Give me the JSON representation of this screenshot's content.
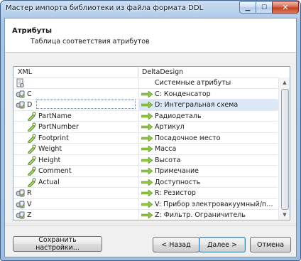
{
  "window": {
    "title": "Мастер импорта библиотеки из файла формата DDL",
    "min_icon": "minimize-icon",
    "max_icon": "maximize-icon",
    "close_icon": "close-icon"
  },
  "header": {
    "title": "Атрибуты",
    "subtitle": "Таблица соответствия атрибутов"
  },
  "table": {
    "columns": [
      "XML",
      "DeltaDesign"
    ],
    "rows": [
      {
        "xml": "",
        "delta": "Системные атрибуты",
        "icon": "document-tree-icon",
        "indent": 0,
        "arrow": false,
        "selected": false
      },
      {
        "xml": "C",
        "delta": "C: Конденсатор",
        "icon": "component-icon",
        "indent": 0,
        "arrow": true,
        "selected": false
      },
      {
        "xml": "D",
        "delta": "D: Интегральная схема",
        "icon": "component-icon",
        "indent": 0,
        "arrow": true,
        "selected": true
      },
      {
        "xml": "PartName",
        "delta": "Радиодеталь",
        "icon": "attribute-icon",
        "indent": 1,
        "arrow": true,
        "selected": false
      },
      {
        "xml": "PartNumber",
        "delta": "Артикул",
        "icon": "attribute-icon",
        "indent": 1,
        "arrow": true,
        "selected": false
      },
      {
        "xml": "Footprint",
        "delta": "Посадочное место",
        "icon": "attribute-icon",
        "indent": 1,
        "arrow": true,
        "selected": false
      },
      {
        "xml": "Weight",
        "delta": "Масса",
        "icon": "attribute-icon",
        "indent": 1,
        "arrow": true,
        "selected": false
      },
      {
        "xml": "Height",
        "delta": "Высота",
        "icon": "attribute-icon",
        "indent": 1,
        "arrow": true,
        "selected": false
      },
      {
        "xml": "Comment",
        "delta": "Примечание",
        "icon": "attribute-icon",
        "indent": 1,
        "arrow": true,
        "selected": false
      },
      {
        "xml": "Actual",
        "delta": "Доступность",
        "icon": "attribute-icon",
        "indent": 1,
        "arrow": true,
        "selected": false
      },
      {
        "xml": "R",
        "delta": "R: Резистор",
        "icon": "component-icon",
        "indent": 0,
        "arrow": true,
        "selected": false
      },
      {
        "xml": "V",
        "delta": "V: Прибор электровакуумный/полупроводниковый",
        "icon": "component-icon",
        "indent": 0,
        "arrow": true,
        "selected": false
      },
      {
        "xml": "Z",
        "delta": "Z: Фильтр. Ограничитель",
        "icon": "component-icon",
        "indent": 0,
        "arrow": true,
        "selected": false
      }
    ]
  },
  "buttons": {
    "save": "Сохранить настройки...",
    "back": "< Назад",
    "next": "Далее >",
    "cancel": "Отмена"
  },
  "colors": {
    "arrow": "#8fc63c",
    "selection": "#dde8f6",
    "close_button": "#c23c20"
  }
}
